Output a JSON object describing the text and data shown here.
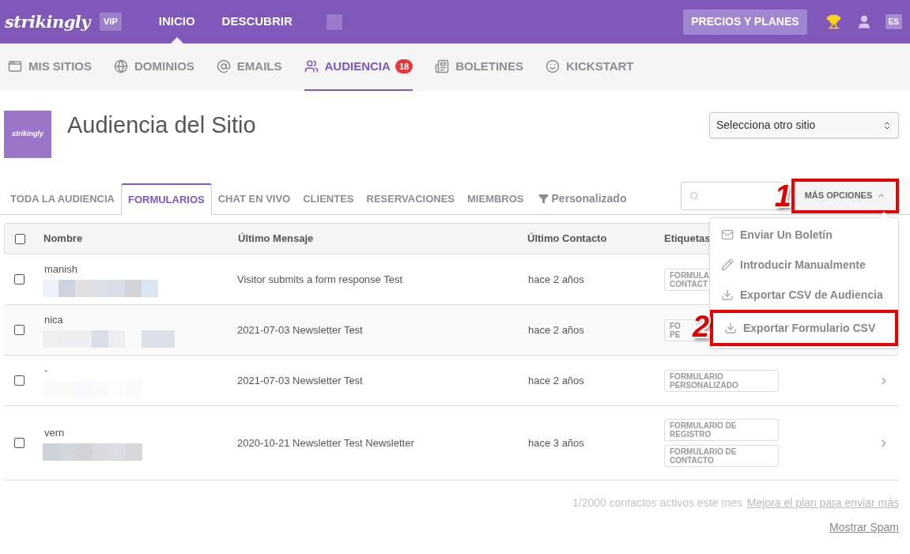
{
  "top_bar": {
    "logo": "strikingly",
    "plan_badge": "VIP",
    "nav": [
      {
        "label": "INICIO",
        "selected": true
      },
      {
        "label": "DESCUBRIR",
        "selected": false
      }
    ],
    "pricing_button": "PRECIOS Y PLANES",
    "language": "ES"
  },
  "section_tabs": [
    {
      "label": "MIS SITIOS",
      "selected": false
    },
    {
      "label": "DOMINIOS",
      "selected": false
    },
    {
      "label": "EMAILS",
      "selected": false
    },
    {
      "label": "AUDIENCIA",
      "selected": true,
      "badge": "18"
    },
    {
      "label": "BOLETINES",
      "selected": false
    },
    {
      "label": "KICKSTART",
      "selected": false
    }
  ],
  "site": {
    "logo": "strikingly",
    "title": "Audiencia del Sitio",
    "site_select": "Selecciona otro sitio"
  },
  "audience_tabs": [
    {
      "label": "TODA LA AUDIENCIA",
      "selected": false
    },
    {
      "label": "FORMULARIOS",
      "selected": true
    },
    {
      "label": "CHAT EN VIVO",
      "selected": false
    },
    {
      "label": "CLIENTES",
      "selected": false
    },
    {
      "label": "RESERVACIONES",
      "selected": false
    },
    {
      "label": "MIEMBROS",
      "selected": false
    }
  ],
  "custom_filter": "Personalizado",
  "more_options": {
    "label": "MÁS OPCIONES",
    "expanded": true,
    "annotation": "1",
    "items": [
      {
        "label": "Enviar Un Boletín",
        "kind": "mail"
      },
      {
        "label": "Introducir Manualmente",
        "kind": "pencil"
      },
      {
        "label": "Exportar CSV de Audiencia",
        "kind": "download"
      },
      {
        "label": "Exportar Formulario CSV",
        "kind": "download",
        "annotation": "2"
      }
    ]
  },
  "table": {
    "select_all_checked": false,
    "columns": [
      "Nombre",
      "Último Mensaje",
      "Último Contacto",
      "Etiquetas"
    ],
    "rows": [
      {
        "checked": false,
        "name": "manish",
        "message": "Visitor submits a form response Test",
        "contact": "hace 2 años",
        "tags": [
          "FORMULA CONTACT"
        ],
        "arrow": false
      },
      {
        "checked": false,
        "name": "nica",
        "message": "2021-07-03 Newsletter Test",
        "contact": "hace 2 años",
        "tags": [
          "FO PE"
        ],
        "arrow": false
      },
      {
        "checked": false,
        "name": "-",
        "message": "2021-07-03 Newsletter Test",
        "contact": "hace 2 años",
        "tags": [
          "FORMULARIO PERSONALIZADO"
        ],
        "arrow": true
      },
      {
        "checked": false,
        "name": "vern",
        "message": "2020-10-21 Newsletter Test Newsletter",
        "contact": "hace 3 años",
        "tags": [
          "FORMULARIO DE REGISTRO",
          "FORMULARIO DE CONTACTO"
        ],
        "arrow": true
      }
    ]
  },
  "footer": {
    "usage": "1/2000 contactos activos este mes",
    "upgrade_link": "Mejora el plan para enviar más",
    "spam_link": "Mostrar Spam"
  }
}
